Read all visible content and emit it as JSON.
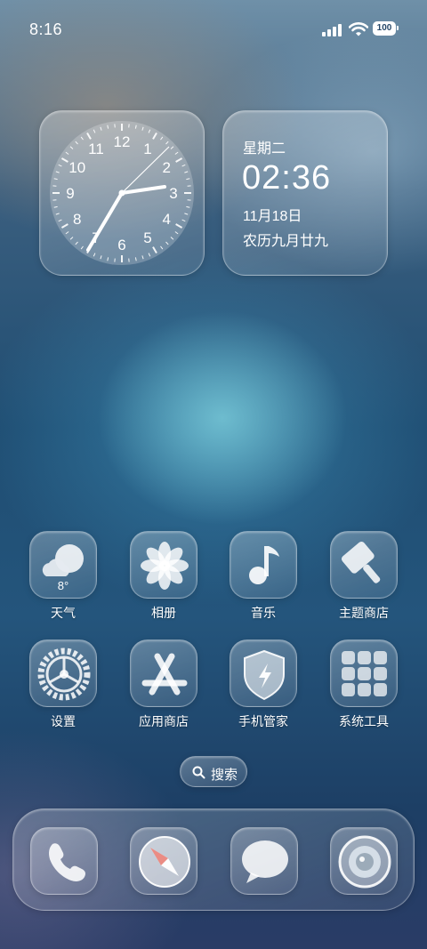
{
  "status_bar": {
    "time": "8:16",
    "battery": "100"
  },
  "widgets": {
    "clock": {
      "numbers": [
        "12",
        "1",
        "2",
        "3",
        "4",
        "5",
        "6",
        "7",
        "8",
        "9",
        "10",
        "11"
      ]
    },
    "date": {
      "weekday": "星期二",
      "time": "02:36",
      "date": "11月18日",
      "lunar": "农历九月廿九"
    }
  },
  "apps": [
    {
      "label": "天气",
      "icon": "weather-icon",
      "badge_text": "8°"
    },
    {
      "label": "相册",
      "icon": "photos-flower-icon"
    },
    {
      "label": "音乐",
      "icon": "music-note-icon"
    },
    {
      "label": "主题商店",
      "icon": "paint-brush-icon"
    },
    {
      "label": "设置",
      "icon": "gear-icon"
    },
    {
      "label": "应用商店",
      "icon": "app-store-icon"
    },
    {
      "label": "手机管家",
      "icon": "shield-bolt-icon"
    },
    {
      "label": "系统工具",
      "icon": "tools-folder-icon"
    }
  ],
  "search": {
    "label": "搜索",
    "icon": "search-icon"
  },
  "dock": [
    {
      "icon": "phone-icon"
    },
    {
      "icon": "compass-icon"
    },
    {
      "icon": "message-bubble-icon"
    },
    {
      "icon": "camera-icon"
    }
  ],
  "colors": {
    "text": "#ffffff",
    "glass_border": "rgba(255,255,255,0.35)"
  }
}
